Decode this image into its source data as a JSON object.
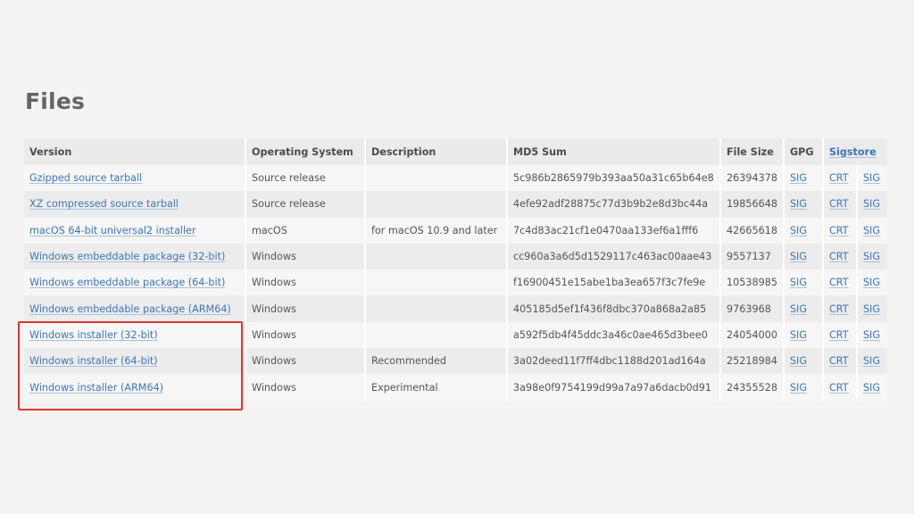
{
  "page": {
    "title": "Files",
    "highlight_color": "#e0342b",
    "link_color": "#3d76b8"
  },
  "table": {
    "headers": {
      "version": "Version",
      "os": "Operating System",
      "description": "Description",
      "md5": "MD5 Sum",
      "size": "File Size",
      "gpg": "GPG",
      "sigstore": "Sigstore"
    },
    "rows": [
      {
        "version": "Gzipped source tarball",
        "os": "Source release",
        "description": "",
        "md5": "5c986b2865979b393aa50a31c65b64e8",
        "size": "26394378",
        "gpg": "SIG",
        "crt": "CRT",
        "sig": "SIG"
      },
      {
        "version": "XZ compressed source tarball",
        "os": "Source release",
        "description": "",
        "md5": "4efe92adf28875c77d3b9b2e8d3bc44a",
        "size": "19856648",
        "gpg": "SIG",
        "crt": "CRT",
        "sig": "SIG"
      },
      {
        "version": "macOS 64-bit universal2 installer",
        "os": "macOS",
        "description": "for macOS 10.9 and later",
        "md5": "7c4d83ac21cf1e0470aa133ef6a1fff6",
        "size": "42665618",
        "gpg": "SIG",
        "crt": "CRT",
        "sig": "SIG"
      },
      {
        "version": "Windows embeddable package (32-bit)",
        "os": "Windows",
        "description": "",
        "md5": "cc960a3a6d5d1529117c463ac00aae43",
        "size": "9557137",
        "gpg": "SIG",
        "crt": "CRT",
        "sig": "SIG"
      },
      {
        "version": "Windows embeddable package (64-bit)",
        "os": "Windows",
        "description": "",
        "md5": "f16900451e15abe1ba3ea657f3c7fe9e",
        "size": "10538985",
        "gpg": "SIG",
        "crt": "CRT",
        "sig": "SIG"
      },
      {
        "version": "Windows embeddable package (ARM64)",
        "os": "Windows",
        "description": "",
        "md5": "405185d5ef1f436f8dbc370a868a2a85",
        "size": "9763968",
        "gpg": "SIG",
        "crt": "CRT",
        "sig": "SIG"
      },
      {
        "version": "Windows installer (32-bit)",
        "os": "Windows",
        "description": "",
        "md5": "a592f5db4f45ddc3a46c0ae465d3bee0",
        "size": "24054000",
        "gpg": "SIG",
        "crt": "CRT",
        "sig": "SIG"
      },
      {
        "version": "Windows installer (64-bit)",
        "os": "Windows",
        "description": "Recommended",
        "md5": "3a02deed11f7ff4dbc1188d201ad164a",
        "size": "25218984",
        "gpg": "SIG",
        "crt": "CRT",
        "sig": "SIG"
      },
      {
        "version": "Windows installer (ARM64)",
        "os": "Windows",
        "description": "Experimental",
        "md5": "3a98e0f9754199d99a7a97a6dacb0d91",
        "size": "24355528",
        "gpg": "SIG",
        "crt": "CRT",
        "sig": "SIG"
      }
    ]
  }
}
